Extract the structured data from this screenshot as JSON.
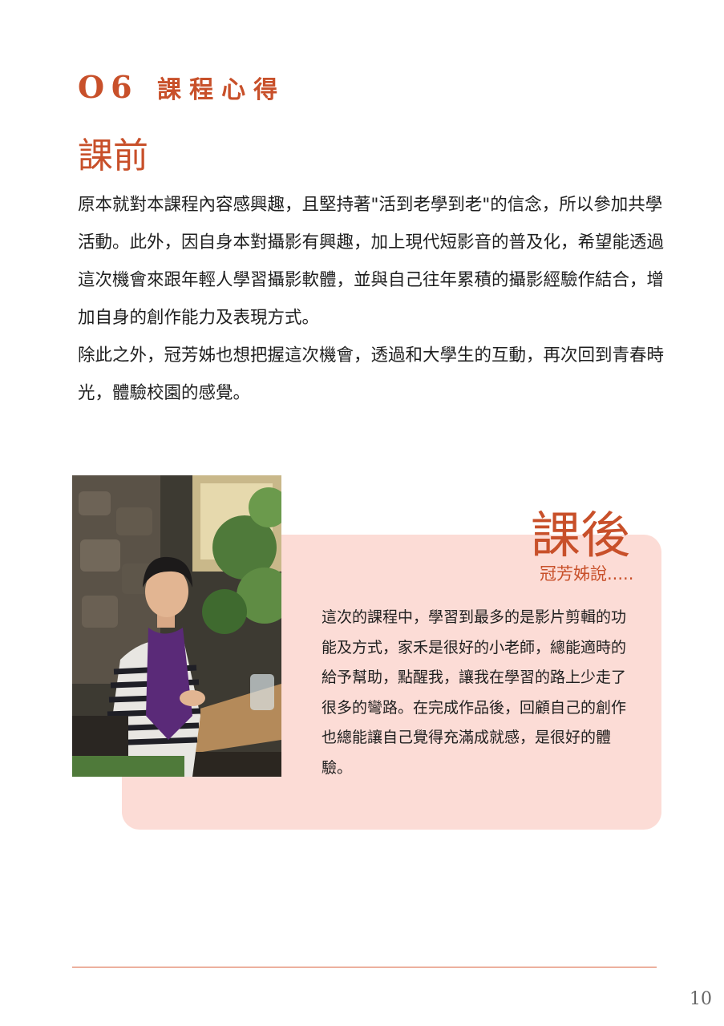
{
  "section": {
    "number": "O6",
    "title": "課程心得"
  },
  "before": {
    "title": "課前",
    "paragraphs": [
      "原本就對本課程內容感興趣，且堅持著\"活到老學到老\"的信念，所以參加共學活動。此外，因自身本對攝影有興趣，加上現代短影音的普及化，希望能透過這次機會來跟年輕人學習攝影軟體，並與自己往年累積的攝影經驗作結合，增加自身的創作能力及表現方式。",
      "除此之外，冠芳姊也想把握這次機會，透過和大學生的互動，再次回到青春時光，體驗校園的感覺。"
    ]
  },
  "after": {
    "title": "課後",
    "subtitle": "冠芳姊說.....",
    "body": "這次的課程中，學習到最多的是影片剪輯的功能及方式，家禾是很好的小老師，總能適時的給予幫助，點醒我，讓我在學習的路上少走了很多的彎路。在完成作品後，回顧自己的創作也總能讓自己覺得充滿成就感，是很好的體驗。"
  },
  "page_number": "10",
  "colors": {
    "accent": "#c8502a",
    "card_background": "#fcdcd6",
    "footer_line": "#d9603a"
  }
}
